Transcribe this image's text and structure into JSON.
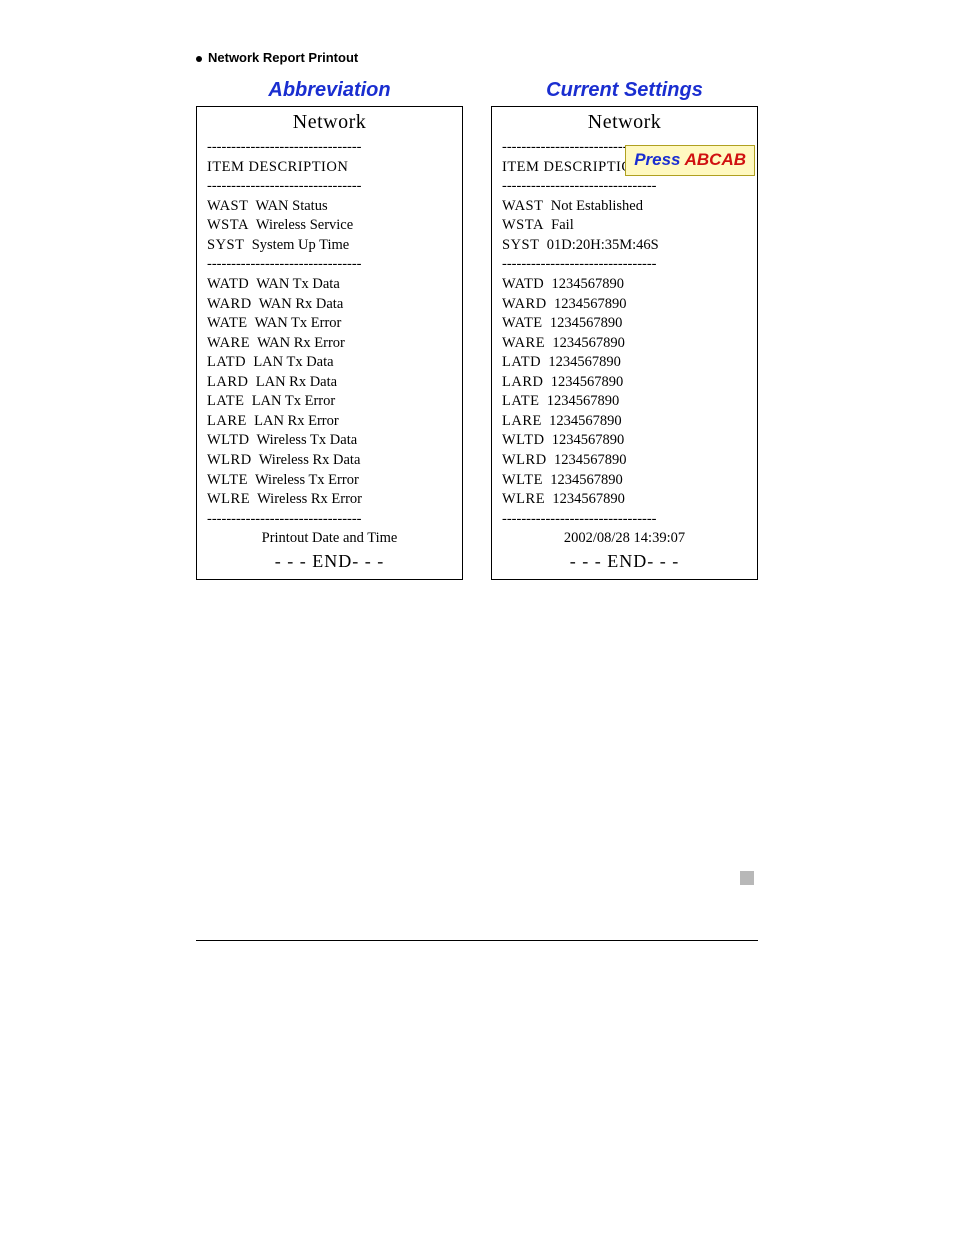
{
  "section_title": "Network Report Printout",
  "columns": {
    "left": {
      "header": "Abbreviation",
      "panel_title": "Network",
      "item_header": "ITEM  DESCRIPTION",
      "group1": [
        {
          "code": "WAST",
          "desc": "WAN Status"
        },
        {
          "code": "WSTA",
          "desc": "Wireless Service"
        },
        {
          "code": "SYST",
          "desc": "System Up Time"
        }
      ],
      "group2": [
        {
          "code": "WATD",
          "desc": "WAN Tx Data"
        },
        {
          "code": "WARD",
          "desc": "WAN Rx Data"
        },
        {
          "code": "WATE",
          "desc": "WAN Tx Error"
        },
        {
          "code": "WARE",
          "desc": "WAN Rx Error"
        },
        {
          "code": "LATD",
          "desc": "LAN Tx Data"
        },
        {
          "code": "LARD",
          "desc": "LAN Rx Data"
        },
        {
          "code": "LATE",
          "desc": "LAN Tx Error"
        },
        {
          "code": "LARE",
          "desc": "LAN Rx Error"
        },
        {
          "code": "WLTD",
          "desc": "Wireless Tx Data"
        },
        {
          "code": "WLRD",
          "desc": "Wireless Rx Data"
        },
        {
          "code": "WLTE",
          "desc": "Wireless Tx Error"
        },
        {
          "code": "WLRE",
          "desc": "Wireless Rx Error"
        }
      ],
      "footer": "Printout Date and Time",
      "end": "- - - END- - -"
    },
    "right": {
      "header": "Current Settings",
      "panel_title": "Network",
      "item_header": "ITEM  DESCRIPTION",
      "callout_press": "Press ",
      "callout_key": "ABCAB",
      "group1": [
        {
          "code": "WAST",
          "val": "Not Established"
        },
        {
          "code": "WSTA",
          "val": "Fail"
        },
        {
          "code": "SYST",
          "val": "01D:20H:35M:46S"
        }
      ],
      "group2": [
        {
          "code": "WATD",
          "val": "1234567890"
        },
        {
          "code": "WARD",
          "val": "1234567890"
        },
        {
          "code": "WATE",
          "val": "1234567890"
        },
        {
          "code": "WARE",
          "val": "1234567890"
        },
        {
          "code": "LATD",
          "val": "1234567890"
        },
        {
          "code": "LARD",
          "val": "1234567890"
        },
        {
          "code": "LATE",
          "val": "1234567890"
        },
        {
          "code": "LARE",
          "val": "1234567890"
        },
        {
          "code": "WLTD",
          "val": "1234567890"
        },
        {
          "code": "WLRD",
          "val": "1234567890"
        },
        {
          "code": "WLTE",
          "val": "1234567890"
        },
        {
          "code": "WLRE",
          "val": "1234567890"
        }
      ],
      "footer": "2002/08/28 14:39:07",
      "end": "- - - END- - -"
    }
  },
  "dashes": "--------------------------------"
}
